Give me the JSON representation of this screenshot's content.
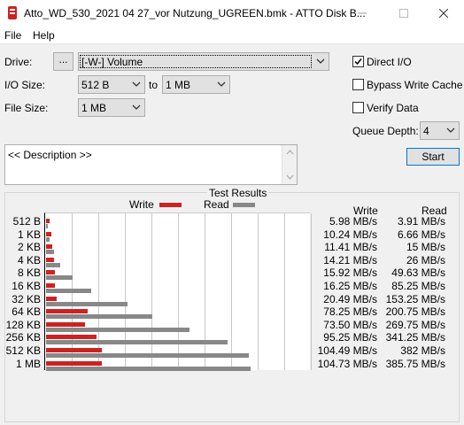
{
  "window": {
    "title": "Atto_WD_530_2021 04 27_vor Nutzung_UGREEN.bmk - ATTO Disk B..."
  },
  "menu": {
    "file": "File",
    "help": "Help"
  },
  "controls": {
    "drive_label": "Drive:",
    "browse_label": "...",
    "drive_value": "[-W-] Volume",
    "io_size_label": "I/O Size:",
    "io_from": "512 B",
    "io_to_label": "to",
    "io_to": "1 MB",
    "file_size_label": "File Size:",
    "file_size": "1 MB",
    "direct_io_label": "Direct I/O",
    "bypass_label": "Bypass Write Cache",
    "verify_label": "Verify Data",
    "queue_depth_label": "Queue Depth:",
    "queue_depth": "4",
    "start_label": "Start",
    "description": "<< Description >>",
    "direct_io_checked": true,
    "bypass_checked": false,
    "verify_checked": false
  },
  "results": {
    "title": "Test Results",
    "legend_write": "Write",
    "legend_read": "Read",
    "col_write": "Write",
    "col_read": "Read",
    "write_values": [
      "5.98 MB/s",
      "10.24 MB/s",
      "11.41 MB/s",
      "14.21 MB/s",
      "15.92 MB/s",
      "16.25 MB/s",
      "20.49 MB/s",
      "78.25 MB/s",
      "73.50 MB/s",
      "95.25 MB/s",
      "104.49 MB/s",
      "104.73 MB/s"
    ],
    "read_values": [
      "3.91 MB/s",
      "6.66 MB/s",
      "15 MB/s",
      "26 MB/s",
      "49.63 MB/s",
      "85.25 MB/s",
      "153.25 MB/s",
      "200.75 MB/s",
      "269.75 MB/s",
      "341.25 MB/s",
      "382 MB/s",
      "385.75 MB/s"
    ]
  },
  "chart_data": {
    "type": "bar",
    "categories": [
      "512 B",
      "1 KB",
      "2 KB",
      "4 KB",
      "8 KB",
      "16 KB",
      "32 KB",
      "64 KB",
      "128 KB",
      "256 KB",
      "512 KB",
      "1 MB"
    ],
    "series": [
      {
        "name": "Write",
        "values": [
          5.98,
          10.24,
          11.41,
          14.21,
          15.92,
          16.25,
          20.49,
          78.25,
          73.5,
          95.25,
          104.49,
          104.73
        ]
      },
      {
        "name": "Read",
        "values": [
          3.91,
          6.66,
          15,
          26,
          49.63,
          85.25,
          153.25,
          200.75,
          269.75,
          341.25,
          382,
          385.75
        ]
      }
    ],
    "xlim": [
      0,
      500
    ],
    "grid": true,
    "legend": "top-center",
    "colors": {
      "Write": "#cc2222",
      "Read": "#888888"
    }
  }
}
